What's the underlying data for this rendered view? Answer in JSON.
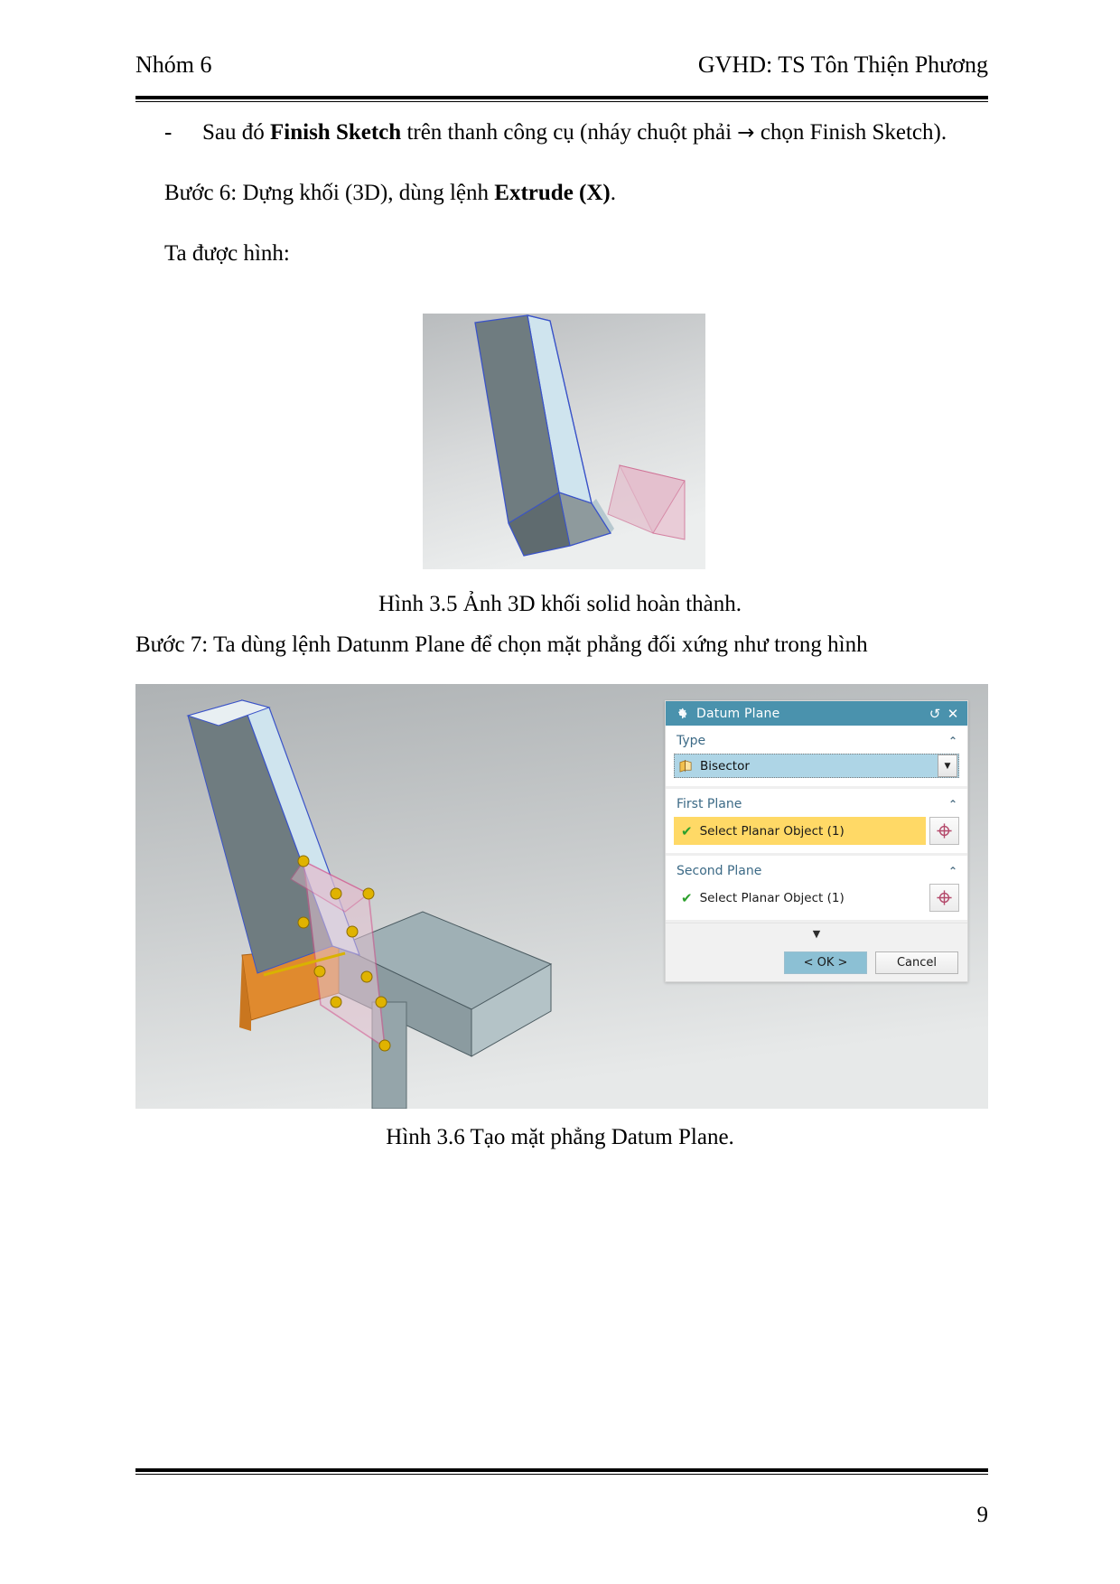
{
  "header": {
    "left": "Nhóm 6",
    "right": "GVHD: TS Tôn Thiện Phương"
  },
  "body": {
    "bullet_dash": "-",
    "bullet_before_bold": "Sau đó ",
    "bullet_bold": "Finish Sketch",
    "bullet_after_bold": " trên thanh công cụ (nháy chuột phải ",
    "bullet_arrow": "→",
    "bullet_tail": " chọn Finish Sketch).",
    "step6_before_bold": "Bước 6: Dựng khối (3D), dùng lệnh ",
    "step6_bold": "Extrude (X)",
    "step6_after_bold": ".",
    "result_line": "Ta được hình:",
    "step7": "Bước 7:  Ta dùng lệnh Datunm Plane để chọn mặt phẳng đối xứng như trong hình"
  },
  "figures": {
    "fig35_caption": "Hình 3.5 Ảnh 3D khối solid hoàn thành.",
    "fig36_caption": "Hình 3.6 Tạo mặt phẳng Datum Plane."
  },
  "dialog": {
    "title": "Datum Plane",
    "title_icons": {
      "gear": "gear-icon",
      "reset": "↺",
      "close": "✕"
    },
    "type_section": {
      "label": "Type",
      "collapse_glyph": "⌃",
      "selected_value": "Bisector",
      "dropdown_glyph": "▼"
    },
    "first_plane": {
      "label": "First Plane",
      "collapse_glyph": "⌃",
      "select_text": "Select Planar Object (1)",
      "check_glyph": "✔"
    },
    "second_plane": {
      "label": "Second Plane",
      "collapse_glyph": "⌃",
      "select_text": "Select Planar Object (1)",
      "check_glyph": "✔"
    },
    "expander_glyph": "▼",
    "ok_label": "< OK >",
    "cancel_label": "Cancel"
  },
  "footer": {
    "page_number": "9"
  },
  "colors": {
    "dialog_title_bar": "#4a92ad",
    "combo_selected": "#aed5e6",
    "select_field_highlight": "#ffd966",
    "ok_button": "#8cc0d4",
    "check_green": "#2ca02c",
    "section_label": "#3c6a86"
  }
}
